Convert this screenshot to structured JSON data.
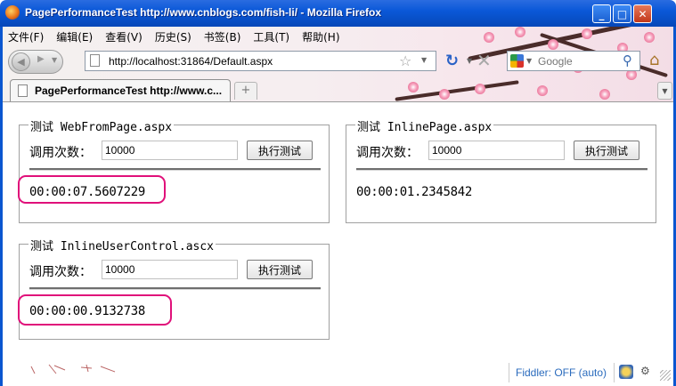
{
  "window": {
    "title": "PagePerformanceTest http://www.cnblogs.com/fish-li/ - Mozilla Firefox",
    "buttons": {
      "minimize": "_",
      "maximize": "□",
      "close": "✕"
    }
  },
  "menu": [
    "文件(F)",
    "编辑(E)",
    "查看(V)",
    "历史(S)",
    "书签(B)",
    "工具(T)",
    "帮助(H)"
  ],
  "nav": {
    "url": "http://localhost:31864/Default.aspx",
    "search_placeholder": "Google"
  },
  "tab": {
    "title": "PagePerformanceTest http://www.c...",
    "new_tab": "+"
  },
  "panels": {
    "webfrompage": {
      "legend": "测试 WebFromPage.aspx",
      "label": "调用次数：",
      "count": "10000",
      "button": "执行测试",
      "result": "00:00:07.5607229",
      "highlighted": true
    },
    "inlinepage": {
      "legend": "测试 InlinePage.aspx",
      "label": "调用次数：",
      "count": "10000",
      "button": "执行测试",
      "result": "00:00:01.2345842",
      "highlighted": false
    },
    "inlineusercontrol": {
      "legend": "测试 InlineUserControl.ascx",
      "label": "调用次数：",
      "count": "10000",
      "button": "执行测试",
      "result": "00:00:00.9132738",
      "highlighted": true
    }
  },
  "statusbar": {
    "fiddler": "Fiddler: OFF (auto)"
  },
  "colors": {
    "highlight": "#e0107a",
    "titlebar": "#0a58d8",
    "fiddler_text": "#2a6bbd"
  }
}
